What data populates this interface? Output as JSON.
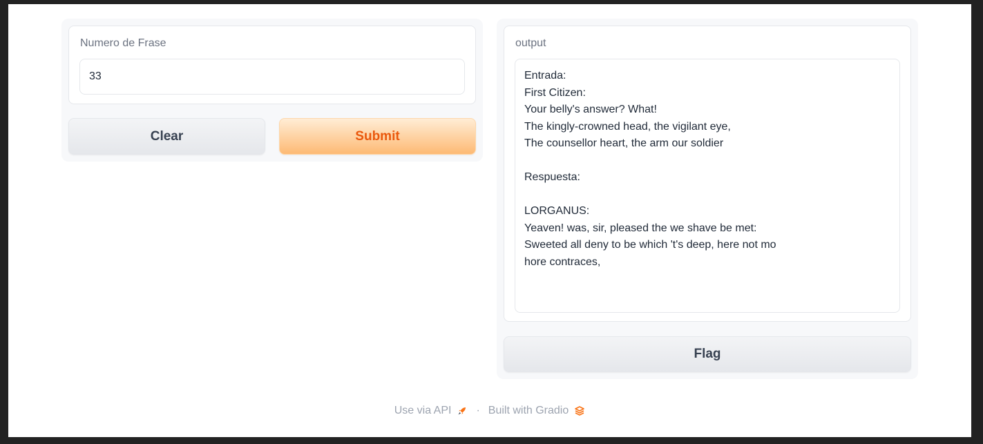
{
  "input_panel": {
    "label": "Numero de Frase",
    "value": "33"
  },
  "actions": {
    "clear_label": "Clear",
    "submit_label": "Submit"
  },
  "output_panel": {
    "label": "output",
    "text": "Entrada:\nFirst Citizen:\nYour belly's answer? What!\nThe kingly-crowned head, the vigilant eye,\nThe counsellor heart, the arm our soldier\n\nRespuesta:\n\nLORGANUS:\nYeaven! was, sir, pleased the we shave be met:\nSweeted all deny to be which 't's deep, here not mo\nhore contraces,",
    "flag_label": "Flag"
  },
  "footer": {
    "api_label": "Use via API",
    "separator": "·",
    "built_label": "Built with Gradio",
    "api_icon": "rocket-icon",
    "gradio_icon": "gradio-logo-icon",
    "accent_color": "#f97316"
  }
}
